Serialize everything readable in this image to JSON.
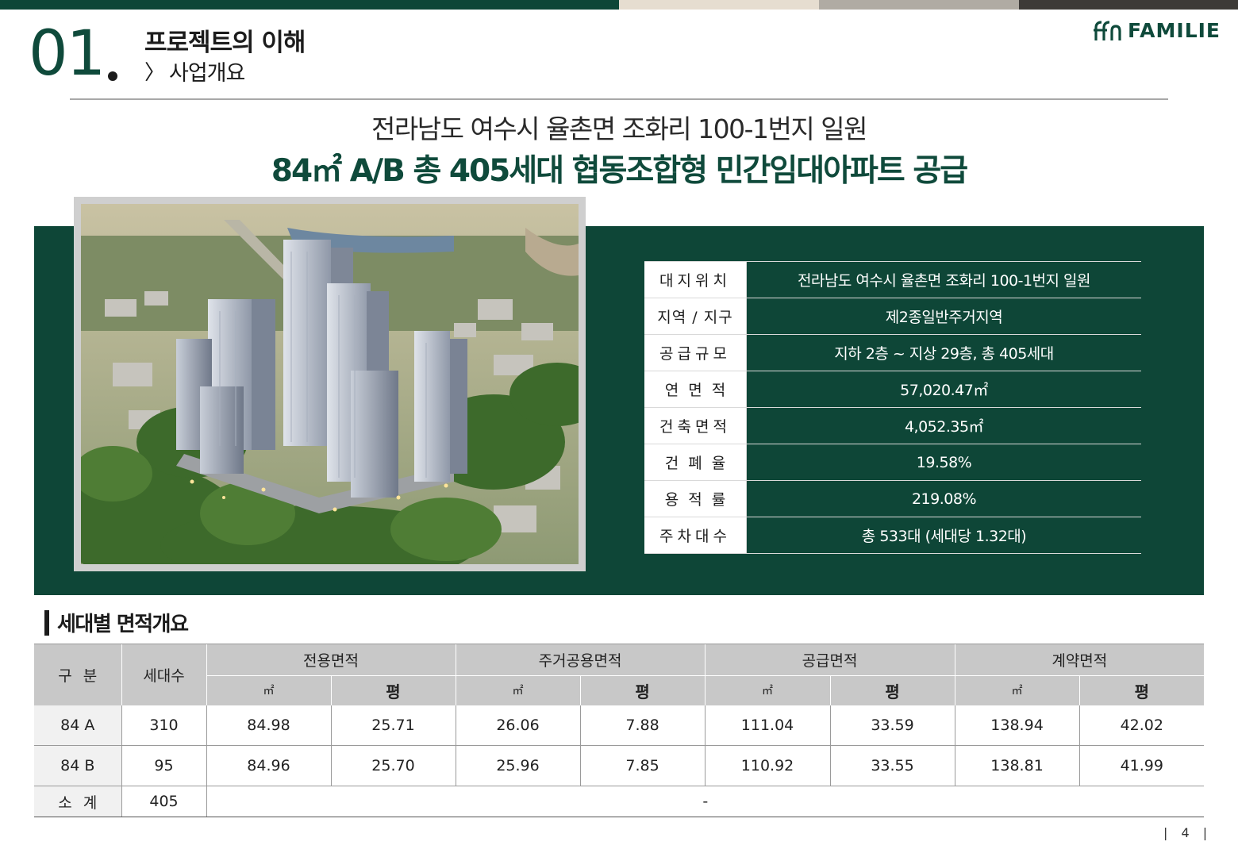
{
  "top_strip": [
    "#0e4637",
    "#e6ddd0",
    "#b0aba3",
    "#3d3a37"
  ],
  "header": {
    "section_number": "01",
    "title": "프로젝트의 이해",
    "subtitle": "사업개요",
    "subtitle_icon": "chevron-right-icon",
    "logo_text": "FAMILIE"
  },
  "headline": {
    "line1": "전라남도 여수시 율촌면 조화리 100-1번지 일원",
    "line2": "84㎡ A/B 총 405세대 협동조합형 민간임대아파트 공급"
  },
  "colors": {
    "brand_green": "#0e4637",
    "header_gray": "#c8c8c8"
  },
  "info": {
    "rows": [
      {
        "key": "대지위치",
        "value": "전라남도 여수시 율촌면 조화리 100-1번지 일원"
      },
      {
        "key": "지역 / 지구",
        "value": "제2종일반주거지역"
      },
      {
        "key": "공급규모",
        "value": "지하 2층 ~ 지상 29층, 총 405세대"
      },
      {
        "key": "연면적",
        "value": "57,020.47㎡"
      },
      {
        "key": "건축면적",
        "value": "4,052.35㎡"
      },
      {
        "key": "건폐율",
        "value": "19.58%"
      },
      {
        "key": "용적률",
        "value": "219.08%"
      },
      {
        "key": "주차대수",
        "value": "총 533대 (세대당 1.32대)"
      }
    ]
  },
  "area_table": {
    "title": "세대별 면적개요",
    "headers": {
      "gubun": "구분",
      "households": "세대수",
      "exclusive": "전용면적",
      "common": "주거공용면적",
      "supply": "공급면적",
      "contract": "계약면적",
      "unit_sqm": "㎡",
      "unit_pyeong": "평"
    },
    "rows": [
      {
        "type": "84 A",
        "households": "310",
        "values": [
          "84.98",
          "25.71",
          "26.06",
          "7.88",
          "111.04",
          "33.59",
          "138.94",
          "42.02"
        ]
      },
      {
        "type": "84 B",
        "households": "95",
        "values": [
          "84.96",
          "25.70",
          "25.96",
          "7.85",
          "110.92",
          "33.55",
          "138.81",
          "41.99"
        ]
      }
    ],
    "total": {
      "label": "소계",
      "households": "405",
      "rest": "-"
    }
  },
  "page_number": "| 4 |"
}
